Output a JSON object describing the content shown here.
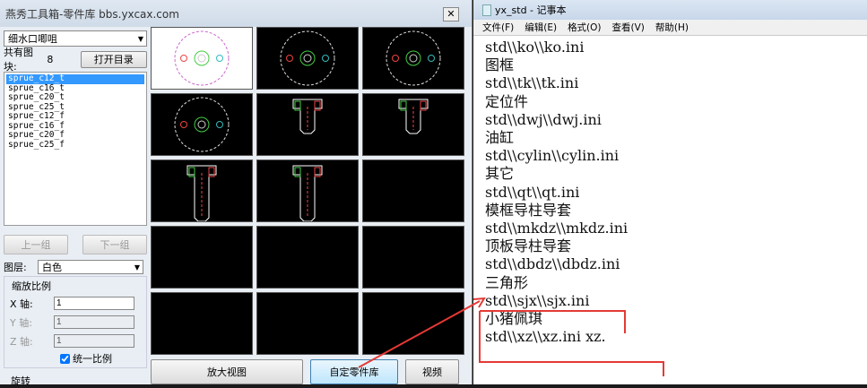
{
  "left_window": {
    "title": "燕秀工具箱-零件库  bbs.yxcax.com",
    "close": "✕",
    "category": "细水口唧咀",
    "count_label": "共有图块:",
    "count": "8",
    "open_dir": "打开目录",
    "items": [
      "sprue_c12_t",
      "sprue_c16_t",
      "sprue_c20_t",
      "sprue_c25_t",
      "sprue_c12_f",
      "sprue_c16_f",
      "sprue_c20_f",
      "sprue_c25_f"
    ],
    "prev": "上一组",
    "next": "下一组",
    "layer_label": "图层:",
    "layer": "白色",
    "scale_title": "缩放比例",
    "x_label": "X 轴:",
    "x": "1",
    "y_label": "Y 轴:",
    "y": "1",
    "z_label": "Z 轴:",
    "z": "1",
    "uniform": "统一比例",
    "rotate": "旋转",
    "zoom_view": "放大视图",
    "custom_lib": "自定零件库",
    "video": "视频"
  },
  "notepad": {
    "title": "yx_std - 记事本",
    "menu": [
      "文件(F)",
      "编辑(E)",
      "格式(O)",
      "查看(V)",
      "帮助(H)"
    ],
    "lines": [
      "std\\\\ko\\\\ko.ini",
      "图框",
      "std\\\\tk\\\\tk.ini",
      "定位件",
      "std\\\\dwj\\\\dwj.ini",
      "油缸",
      "std\\\\cylin\\\\cylin.ini",
      "其它",
      "std\\\\qt\\\\qt.ini",
      "模框导柱导套",
      "std\\\\mkdz\\\\mkdz.ini",
      "顶板导柱导套",
      "std\\\\dbdz\\\\dbdz.ini",
      "三角形",
      "std\\\\sjx\\\\sjx.ini",
      "小猪佩琪",
      "std\\\\xz\\\\xz.ini   xz."
    ]
  },
  "colors": {
    "annotation": "#e53935",
    "selection": "#3399ff"
  }
}
